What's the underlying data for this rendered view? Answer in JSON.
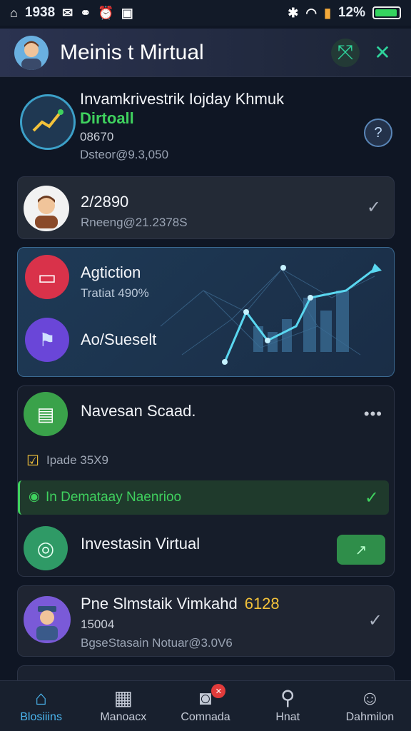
{
  "status_bar": {
    "time": "1938",
    "battery": "12%"
  },
  "header": {
    "title": "Meinis t Mirtual"
  },
  "profile": {
    "title": "Invamkrivestrik Iojday Khmuk",
    "subtitle": "Dirtoall",
    "code": "08670",
    "detail": "Dsteor@9.3,050"
  },
  "summary": {
    "amount": "2/2890",
    "detail": "Rneeng@21.2378S"
  },
  "insights": {
    "item1_title": "Agtiction",
    "item1_sub": "Tratiat 490%",
    "item2_title": "Ao/Sueselt"
  },
  "market": {
    "title": "Navesan Scaad.",
    "note": "Ipade 35X9",
    "banner": "In Demataay Naenrioo",
    "sub_title": "Investasin Virtual"
  },
  "listing": {
    "title": "Pne Slmstaik Vimkahd",
    "value": "6128",
    "code": "15004",
    "detail": "BgseStasain Notuar@3.0V6"
  },
  "bottom_nav": [
    {
      "label": "Blosiiins"
    },
    {
      "label": "Manoacx"
    },
    {
      "label": "Comnada"
    },
    {
      "label": "Hnat"
    },
    {
      "label": "Dahmilon"
    }
  ],
  "colors": {
    "accent": "#3fd15e",
    "active_tab": "#4bb6f0",
    "chart_line": "#5ad7f0"
  }
}
